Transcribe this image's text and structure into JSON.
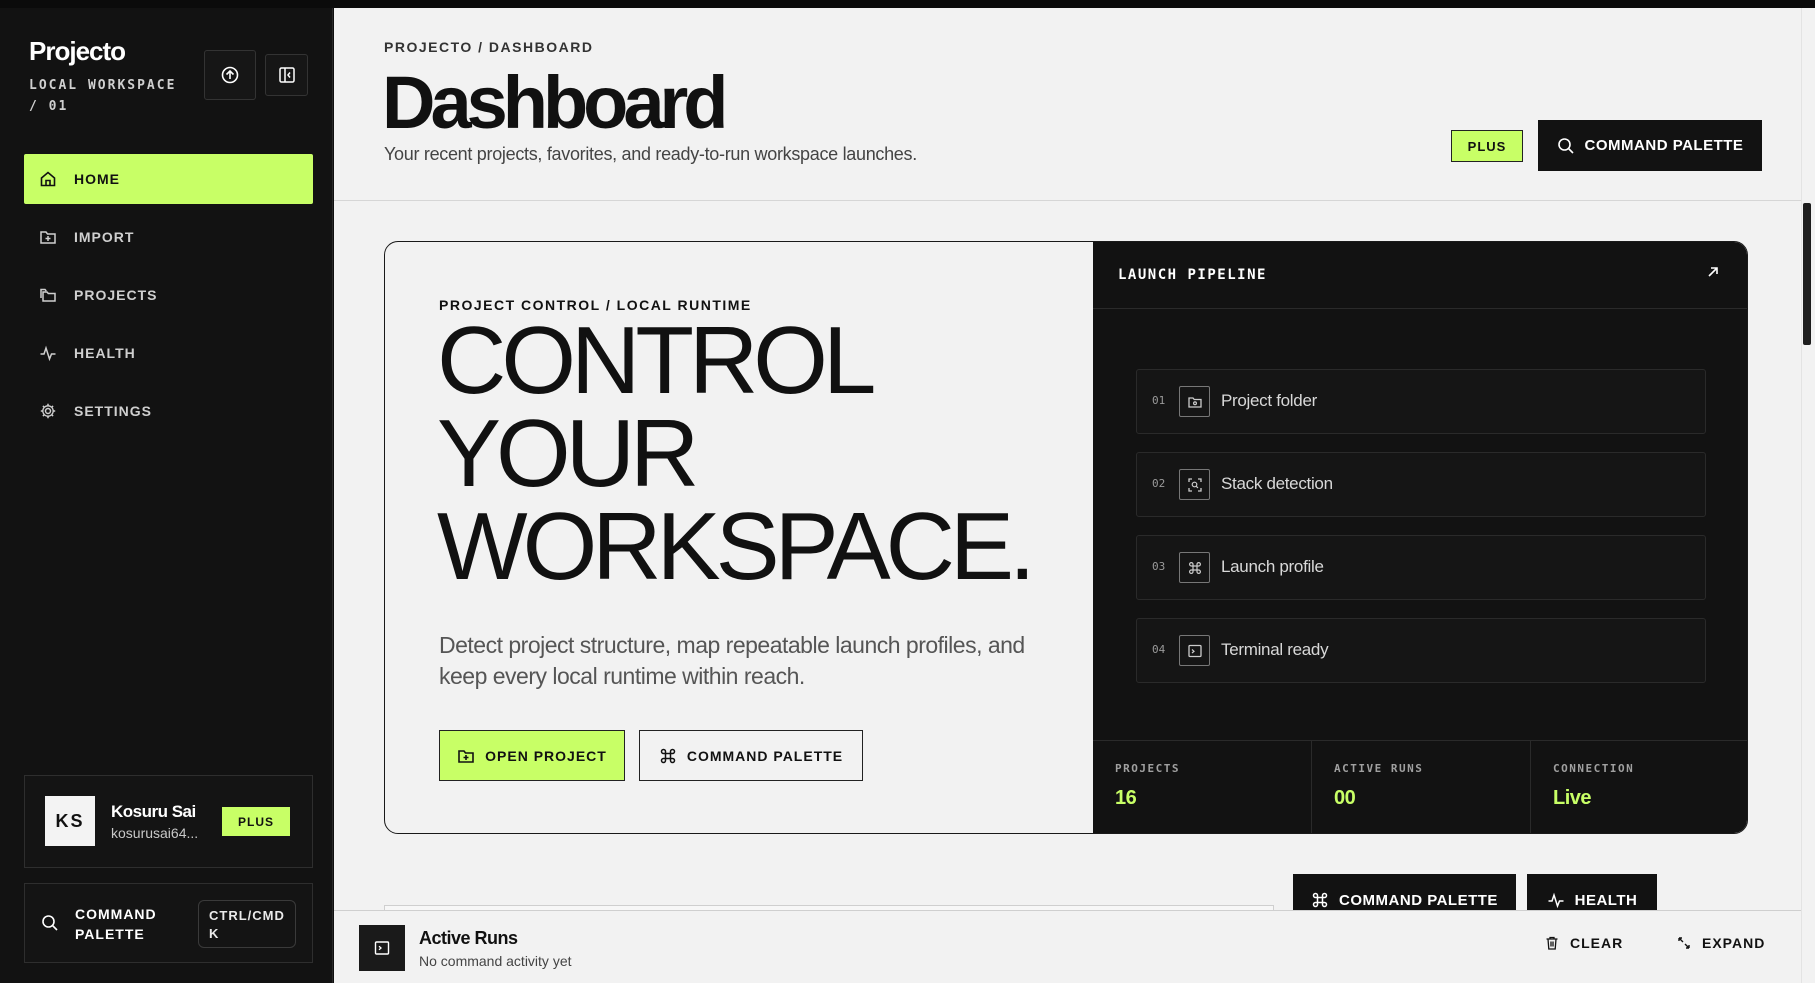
{
  "sidebar": {
    "brand": "Projecto",
    "workspace": "LOCAL WORKSPACE / 01",
    "nav": [
      {
        "label": "HOME",
        "icon": "home-icon",
        "active": true
      },
      {
        "label": "IMPORT",
        "icon": "folder-import-icon",
        "active": false
      },
      {
        "label": "PROJECTS",
        "icon": "folders-icon",
        "active": false
      },
      {
        "label": "HEALTH",
        "icon": "pulse-icon",
        "active": false
      },
      {
        "label": "SETTINGS",
        "icon": "gear-icon",
        "active": false
      }
    ],
    "user": {
      "initials": "KS",
      "name": "Kosuru Sai",
      "email": "kosurusai64...",
      "plan": "PLUS"
    },
    "command": {
      "label": "COMMAND PALETTE",
      "shortcut": "CTRL/CMD K"
    }
  },
  "header": {
    "breadcrumb": "PROJECTO / DASHBOARD",
    "title": "Dashboard",
    "subtitle": "Your recent projects, favorites, and ready-to-run workspace launches.",
    "plan_badge": "PLUS",
    "command_button": "COMMAND PALETTE"
  },
  "hero": {
    "eyebrow": "PROJECT CONTROL / LOCAL RUNTIME",
    "headline_1": "CONTROL",
    "headline_2": "YOUR",
    "headline_3": "WORKSPACE.",
    "description": "Detect project structure, map repeatable launch profiles, and keep every local runtime within reach.",
    "open_button": "OPEN PROJECT",
    "command_button": "COMMAND PALETTE"
  },
  "pipeline": {
    "title": "LAUNCH PIPELINE",
    "steps": [
      {
        "num": "01",
        "label": "Project folder",
        "icon": "folder-icon"
      },
      {
        "num": "02",
        "label": "Stack detection",
        "icon": "scan-icon"
      },
      {
        "num": "03",
        "label": "Launch profile",
        "icon": "command-icon"
      },
      {
        "num": "04",
        "label": "Terminal ready",
        "icon": "terminal-icon"
      }
    ],
    "stats": [
      {
        "label": "PROJECTS",
        "value": "16"
      },
      {
        "label": "ACTIVE RUNS",
        "value": "00"
      },
      {
        "label": "CONNECTION",
        "value": "Live"
      }
    ]
  },
  "lower": {
    "command_button": "COMMAND PALETTE",
    "health_button": "HEALTH"
  },
  "runs": {
    "title": "Active Runs",
    "subtitle": "No command activity yet",
    "clear": "CLEAR",
    "expand": "EXPAND"
  },
  "colors": {
    "accent": "#c8ff66",
    "sidebar_bg": "#121212",
    "main_bg": "#f2f2f2"
  }
}
